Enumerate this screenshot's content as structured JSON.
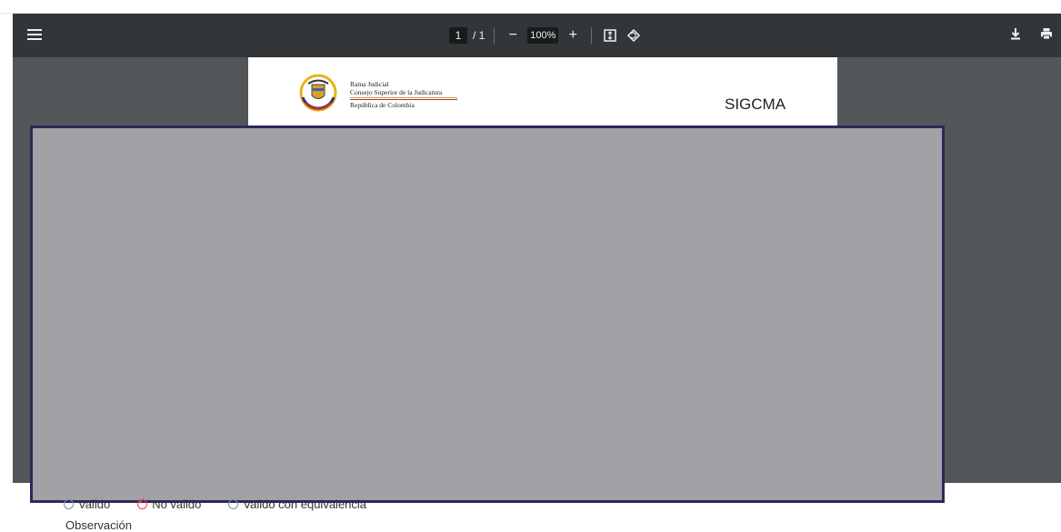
{
  "toolbar": {
    "page_current": "1",
    "page_total": "/ 1",
    "zoom": "100%",
    "icons": [
      "menu-icon",
      "zoom-out-icon",
      "zoom-in-icon",
      "fit-page-icon",
      "rotate-icon",
      "download-icon",
      "print-icon"
    ]
  },
  "document": {
    "org_line1": "Rama Judicial",
    "org_line2": "Consejo Superior de la Judicatura",
    "org_line3": "República de Colombia",
    "system": "SIGCMA"
  },
  "form": {
    "options": [
      "Valido",
      "No valido",
      "Valido con equivalencia"
    ],
    "selected": "No valido",
    "observation_label": "Observación"
  },
  "colors": {
    "toolbar_bg": "#323639",
    "viewer_bg": "#525659",
    "overlay_bg": "#a2a1a5",
    "overlay_border": "#2a2a5a"
  }
}
